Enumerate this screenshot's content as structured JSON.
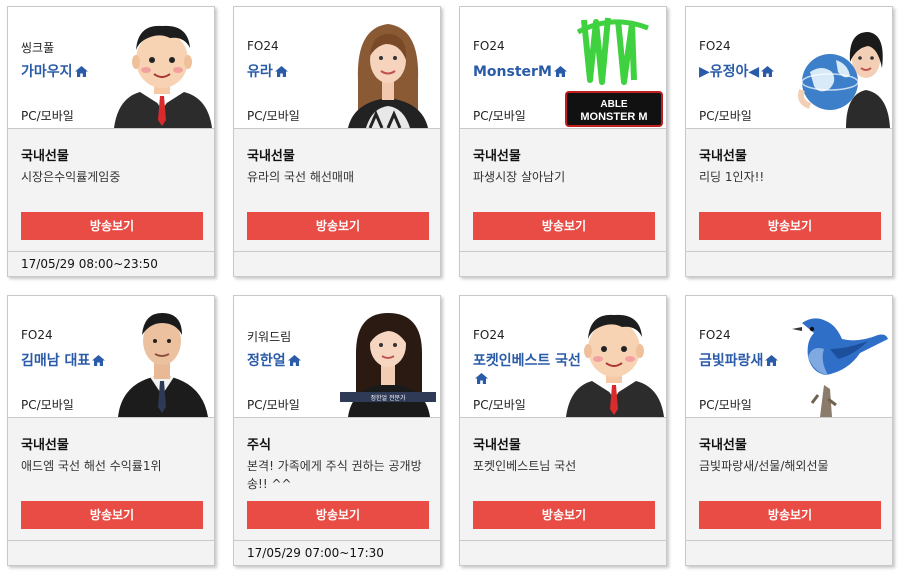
{
  "button_label": "방송보기",
  "colors": {
    "accent": "#e84c45",
    "name": "#2a5ba8"
  },
  "cards": [
    {
      "company": "씽크풀",
      "name": "가마우지",
      "platform": "PC/모바일",
      "category": "국내선물",
      "desc": "시장은수익률게임중",
      "time": "17/05/29 08:00~23:50",
      "photo": "cartoon-man"
    },
    {
      "company": "FO24",
      "name": "유라",
      "platform": "PC/모바일",
      "category": "국내선물",
      "desc": "유라의 국선 해선매매",
      "time": "",
      "photo": "woman-photo"
    },
    {
      "company": "FO24",
      "name": "MonsterM",
      "platform": "PC/모바일",
      "category": "국내선물",
      "desc": "파생시장 살아남기",
      "time": "",
      "photo": "monster-logo",
      "logo_text_1": "ABLE",
      "logo_text_2": "MONSTER M"
    },
    {
      "company": "FO24",
      "name": "▶유정아◀",
      "platform": "PC/모바일",
      "category": "국내선물",
      "desc": "리딩 1인자!!",
      "time": "",
      "photo": "woman-globe"
    },
    {
      "company": "FO24",
      "name": "김매남 대표",
      "platform": "PC/모바일",
      "category": "국내선물",
      "desc": "애드엠 국선 해선 수익률1위",
      "time": "",
      "photo": "man-photo"
    },
    {
      "company": "키워드림",
      "name": "정한얼",
      "platform": "PC/모바일",
      "category": "주식",
      "desc": "본격! 가족에게 주식 권하는 공개방송!! ^^",
      "time": "17/05/29 07:00~17:30",
      "photo": "woman-photo-2",
      "caption": "정한얼 전문가"
    },
    {
      "company": "FO24",
      "name": "포켓인베스트 국선",
      "platform": "PC/모바일",
      "category": "국내선물",
      "desc": "포켓인베스트님 국선",
      "time": "",
      "photo": "cartoon-man"
    },
    {
      "company": "FO24",
      "name": "금빛파랑새",
      "platform": "PC/모바일",
      "category": "국내선물",
      "desc": "금빛파랑새/선물/해외선물",
      "time": "",
      "photo": "bluebird"
    }
  ]
}
